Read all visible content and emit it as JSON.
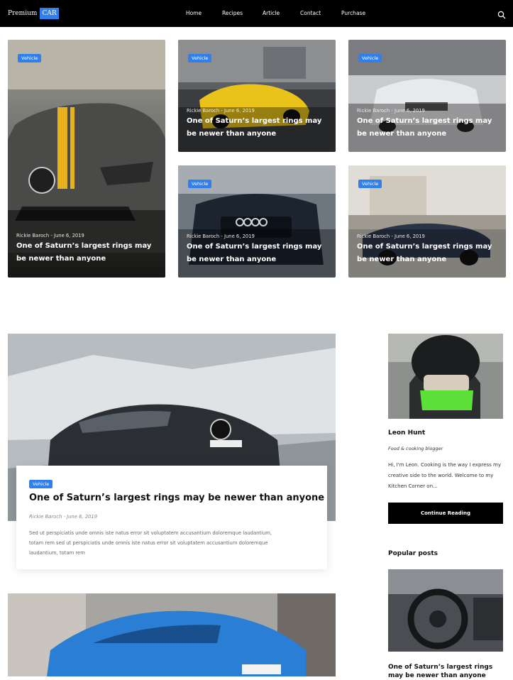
{
  "brand": {
    "name": "Premium",
    "badge": "CAR"
  },
  "nav": {
    "items": [
      "Home",
      "Recipes",
      "Article",
      "Contact",
      "Purchase"
    ]
  },
  "icons": {
    "search": "search-icon"
  },
  "grid": {
    "cards": [
      {
        "tag": "Vehicle",
        "meta": "Rickie Baroch - June 6, 2019",
        "title": "One of Saturn’s largest rings may be newer than anyone"
      },
      {
        "tag": "Vehicle",
        "meta": "Rickie Baroch - June 6, 2019",
        "title": "One of Saturn’s largest rings may be newer than anyone"
      },
      {
        "tag": "Vehicle",
        "meta": "Rickie Baroch - June 6, 2019",
        "title": "One of Saturn’s largest rings may be newer than anyone"
      },
      {
        "tag": "Vehicle",
        "meta": "Rickie Baroch - June 6, 2019",
        "title": "One of Saturn’s largest rings may be newer than anyone"
      },
      {
        "tag": "Vehicle",
        "meta": "Rickie Baroch - June 6, 2019",
        "title": "One of Saturn’s largest rings may be newer than anyone"
      }
    ]
  },
  "featured": {
    "tag": "Vehicle",
    "title": "One of Saturn’s largest rings may be newer than anyone",
    "meta": "Rickie Baroch - June 6, 2019",
    "excerpt": "Sed ut perspiciatis unde omnis iste natus error sit voluptatem accusantium doloremque laudantium, totam rem sed ut perspiciatis unde omnis iste natus error sit voluptatem accusantium doloremque laudantium, totam rem"
  },
  "author": {
    "name": "Leon Hunt",
    "role": "Food & cooking blogger",
    "bio": "Hi, I'm Leon. Cooking is the way I express my creative side to the world. Welcome to my Kitchen Corner on...",
    "cta": "Continue Reading"
  },
  "popular": {
    "heading": "Popular posts",
    "items": [
      {
        "title": "One of Saturn’s largest rings may be newer than anyone"
      }
    ]
  },
  "colors": {
    "accent": "#2f80ed",
    "topbar": "#000000"
  }
}
